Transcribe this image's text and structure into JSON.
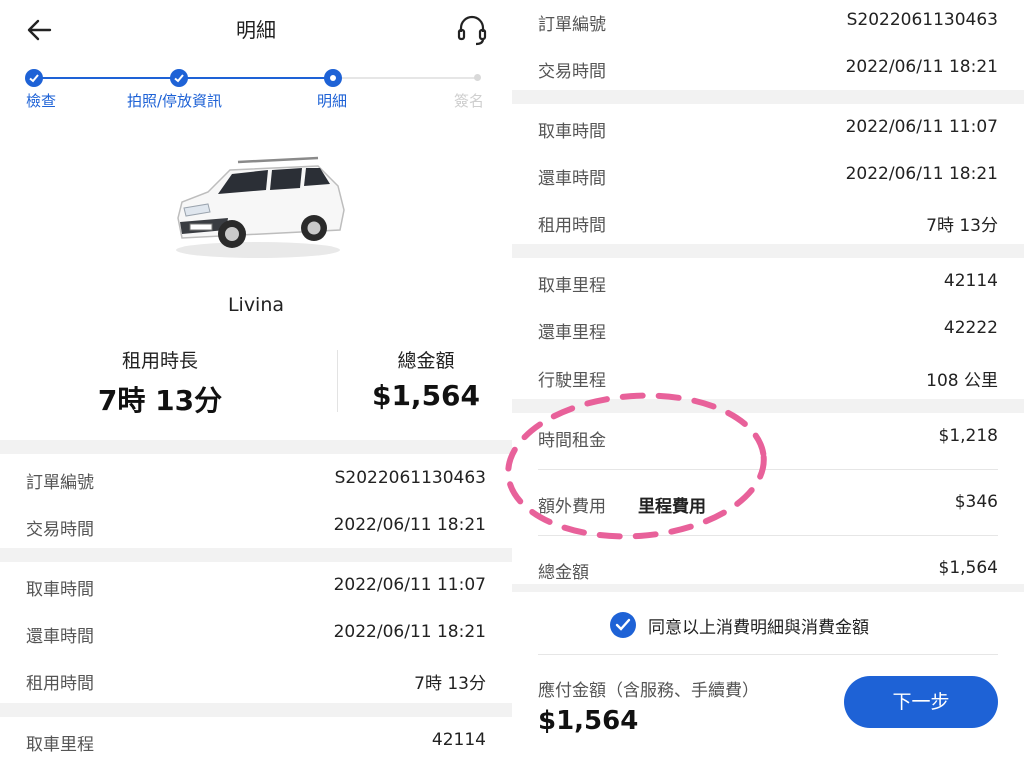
{
  "header": {
    "title": "明細",
    "back_icon": "arrow-left-icon",
    "support_icon": "headset-icon"
  },
  "stepper": {
    "steps": [
      {
        "label": "檢查",
        "state": "done"
      },
      {
        "label": "拍照/停放資訊",
        "state": "done"
      },
      {
        "label": "明細",
        "state": "current"
      },
      {
        "label": "簽名",
        "state": "pending"
      }
    ]
  },
  "car": {
    "name": "Livina"
  },
  "summary": {
    "duration_label": "租用時長",
    "duration_value": "7時 13分",
    "total_label": "總金額",
    "total_value": "$1,564"
  },
  "details": {
    "order_no": {
      "label": "訂單編號",
      "value": "S2022061130463"
    },
    "trade_time": {
      "label": "交易時間",
      "value": "2022/06/11 18:21"
    },
    "pickup_time": {
      "label": "取車時間",
      "value": "2022/06/11 11:07"
    },
    "return_time": {
      "label": "還車時間",
      "value": "2022/06/11 18:21"
    },
    "rental_time": {
      "label": "租用時間",
      "value": "7時  13分"
    },
    "pickup_mileage": {
      "label": "取車里程",
      "value": "42114"
    },
    "return_mileage": {
      "label": "還車里程",
      "value": "42222"
    },
    "driven_mileage": {
      "label": "行駛里程",
      "value": "108 公里"
    },
    "time_rent": {
      "label": "時間租金",
      "value": "$1,218"
    },
    "extra_fee": {
      "label": "額外費用",
      "sub_label": "里程費用",
      "value": "$346"
    },
    "total": {
      "label": "總金額",
      "value": "$1,564"
    }
  },
  "footer": {
    "agree_text": "同意以上消費明細與消費金額",
    "agree_checked": true,
    "payable_label": "應付金額（含服務、手續費）",
    "payable_amount": "$1,564",
    "next_button": "下一步"
  },
  "colors": {
    "primary": "#1e62d6",
    "annotation": "#e8619a"
  }
}
